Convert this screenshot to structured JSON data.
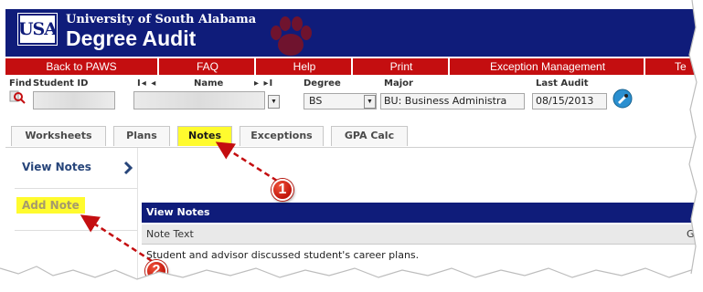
{
  "header": {
    "university": "University of South Alabama",
    "app_title": "Degree Audit",
    "logo_text": "USA",
    "colors": {
      "navy": "#0f1c7a",
      "red": "#c40e10",
      "highlight": "#fffb2e"
    }
  },
  "menu": [
    "Back to PAWS",
    "FAQ",
    "Help",
    "Print",
    "Exception Management",
    "Te"
  ],
  "search": {
    "find_label": "Find",
    "student_id_label": "Student ID",
    "name_label": "Name",
    "degree_label": "Degree",
    "degree_value": "BS",
    "major_label": "Major",
    "major_value": "BU: Business Administra",
    "last_audit_label": "Last Audit",
    "last_audit_value": "08/15/2013",
    "nav_first": "I◂ ◂",
    "nav_last": "▸ ▸I"
  },
  "tabs": [
    "Worksheets",
    "Plans",
    "Notes",
    "Exceptions",
    "GPA Calc"
  ],
  "active_tab": "Notes",
  "left_nav": {
    "view_notes": "View Notes",
    "add_note": "Add Note"
  },
  "notes_panel": {
    "title": "View Notes",
    "column_header": "Note Text",
    "column_header_right": "G",
    "rows": [
      "Student and advisor discussed student's career plans."
    ]
  },
  "callouts": [
    "1",
    "2"
  ]
}
